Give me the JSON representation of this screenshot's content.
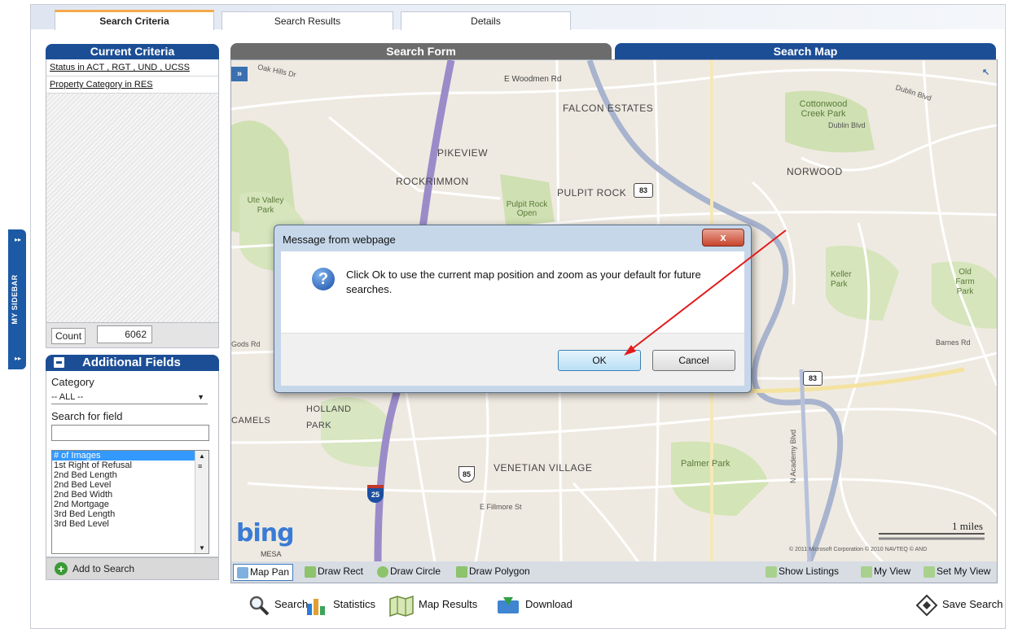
{
  "tabs": [
    {
      "label": "Search Criteria",
      "active": true
    },
    {
      "label": "Search Results",
      "active": false
    },
    {
      "label": "Details",
      "active": false
    }
  ],
  "sidebar_tab_label": "MY SIDEBAR",
  "current_criteria": {
    "title": "Current Criteria",
    "items": [
      "Status in ACT , RGT , UND , UCSS",
      "Property Category in RES"
    ],
    "count_label": "Count",
    "count_value": "6062"
  },
  "additional_fields": {
    "title": "Additional Fields",
    "category_label": "Category",
    "category_value": "-- ALL --",
    "search_label": "Search for field",
    "search_value": "",
    "options": [
      "# of Images",
      "1st Right of Refusal",
      "2nd Bed Length",
      "2nd Bed Level",
      "2nd Bed Width",
      "2nd Mortgage",
      "3rd Bed Length",
      "3rd Bed Level"
    ],
    "selected_option": "# of Images",
    "add_button": "Add to Search"
  },
  "search_form_title": "Search Form",
  "search_map_title": "Search Map",
  "map": {
    "expand_glyph": "»",
    "labels": {
      "oak_hills": "Oak Hills Dr",
      "woodmen": "E Woodmen Rd",
      "falcon_estates": "FALCON ESTATES",
      "cottonwood": "Cottonwood Creek Park",
      "dublin_blvd": "Dublin Blvd",
      "dublin_blvd2": "Dublin Blvd",
      "pikeview": "PIKEVIEW",
      "rockrimmon": "ROCKRIMMON",
      "pulpit_rock": "PULPIT ROCK",
      "pulpit_rock_open": "Pulpit Rock Open",
      "norwood": "NORWOOD",
      "ute_valley": "Ute Valley Park",
      "holland_park": "HOLLAND PARK",
      "camels": "CAMELS",
      "venetian_village": "VENETIAN VILLAGE",
      "palmer_park": "Palmer Park",
      "keller_park": "Keller Park",
      "old_farm_park": "Old Farm Park",
      "barnes_rd": "Barnes Rd",
      "fillmore": "E Fillmore St",
      "gods_rd": "Gods Rd",
      "academy": "N Academy Blvd",
      "scale": "1 miles",
      "copyright": "© 2011 Microsoft Corporation  © 2010 NAVTEQ  © AND",
      "bing": "bing",
      "mesa": "MESA"
    },
    "shields": [
      "83",
      "83",
      "85",
      "25"
    ]
  },
  "map_toolbar": {
    "map_pan": "Map Pan",
    "draw_rect": "Draw Rect",
    "draw_circle": "Draw Circle",
    "draw_polygon": "Draw Polygon",
    "show_listings": "Show Listings",
    "my_view": "My View",
    "set_my_view": "Set My View"
  },
  "bottom_actions": {
    "search": "Search",
    "statistics": "Statistics",
    "map_results": "Map Results",
    "download": "Download",
    "save_search": "Save Search"
  },
  "dialog": {
    "title": "Message from webpage",
    "close_glyph": "x",
    "message": "Click Ok to use the current map position and zoom as your default for future searches.",
    "ok": "OK",
    "cancel": "Cancel"
  },
  "colors": {
    "header_blue": "#1c4e96",
    "tab_accent": "#f3a94a",
    "annotation_arrow": "#e21b1b"
  }
}
